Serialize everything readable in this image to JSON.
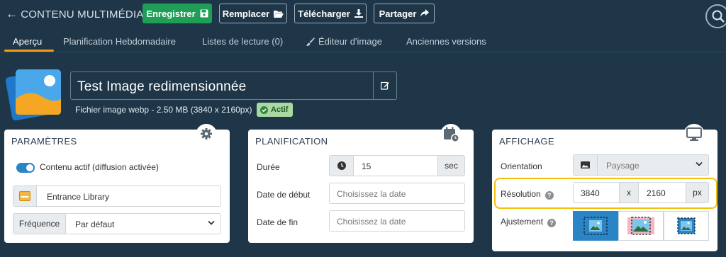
{
  "header": {
    "back_title": "CONTENU MULTIMÉDIA",
    "buttons": {
      "save": "Enregistrer",
      "replace": "Remplacer",
      "download": "Télécharger",
      "share": "Partager"
    }
  },
  "tabs": [
    {
      "label": "Aperçu",
      "active": true
    },
    {
      "label": "Planification Hebdomadaire",
      "active": false
    },
    {
      "label": "Listes de lecture (0)",
      "active": false
    },
    {
      "label": "Éditeur d'image",
      "active": false
    },
    {
      "label": "Anciennes versions",
      "active": false
    }
  ],
  "media": {
    "name": "Test Image redimensionnée",
    "file_info": "Fichier image webp - 2.50 MB (3840 x 2160px)",
    "status": "Actif"
  },
  "parametres": {
    "title": "PARAMÈTRES",
    "active_toggle_label": "Contenu actif (diffusion activée)",
    "active_toggle_on": true,
    "library": "Entrance Library",
    "frequency_label": "Fréquence",
    "frequency_value": "Par défaut"
  },
  "planification": {
    "title": "PLANIFICATION",
    "duration_label": "Durée",
    "duration_value": "15",
    "duration_unit": "sec",
    "start_label": "Date de début",
    "start_placeholder": "Choisissez la date",
    "end_label": "Date de fin",
    "end_placeholder": "Choisissez la date"
  },
  "affichage": {
    "title": "AFFICHAGE",
    "orientation_label": "Orientation",
    "orientation_value": "Paysage",
    "resolution_label": "Résolution",
    "resolution_width": "3840",
    "resolution_sep": "x",
    "resolution_height": "2160",
    "resolution_unit": "px",
    "fit_label": "Ajustement",
    "fit_selected": 0
  },
  "colors": {
    "background": "#1e3647",
    "save_green": "#1e9e57",
    "tab_accent": "#f39c12",
    "toggle_blue": "#2a85c6",
    "highlight_yellow": "#f2c10b",
    "status_badge": "#a9d9a1"
  },
  "icons": {
    "back": "arrow-left-icon",
    "save": "floppy-icon",
    "replace": "folder-open-icon",
    "download": "download-icon",
    "share": "share-icon",
    "search": "search-icon",
    "edit": "pencil-icon",
    "gear": "gear-icon",
    "calendar": "calendar-clock-icon",
    "monitor": "monitor-icon"
  }
}
